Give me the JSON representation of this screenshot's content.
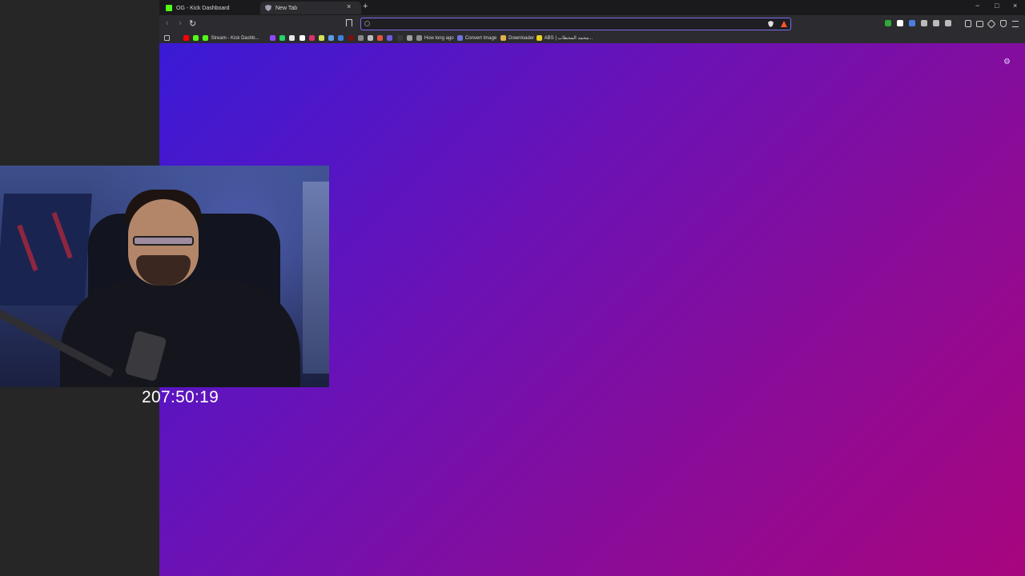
{
  "tabs": [
    {
      "label": "OG - Kick Dashboard",
      "icon": "kick-logo-icon",
      "active": false
    },
    {
      "label": "New Tab",
      "icon": "brave-shield-icon",
      "active": true
    }
  ],
  "tab_close_symbol": "×",
  "new_tab_symbol": "+",
  "window_controls": {
    "minimize": "−",
    "maximize": "□",
    "close": "×"
  },
  "nav": {
    "back": "‹",
    "forward": "›",
    "reload": "↻"
  },
  "address_bar": {
    "value": ""
  },
  "bookmarks": [
    {
      "label": "",
      "icon": "youtube-icon",
      "color": "#ff0000"
    },
    {
      "label": "",
      "icon": "kick-icon",
      "color": "#53fc18"
    },
    {
      "label": "Stream - Kick Dashb...",
      "icon": "kick-icon",
      "color": "#53fc18"
    },
    {
      "label": "",
      "icon": "twitch-icon",
      "color": "#9146ff"
    },
    {
      "label": "",
      "icon": "whatsapp-icon",
      "color": "#25d366"
    },
    {
      "label": "",
      "icon": "x-icon",
      "color": "#e6e6e6"
    },
    {
      "label": "",
      "icon": "tiktok-icon",
      "color": "#ffffff"
    },
    {
      "label": "",
      "icon": "instagram-icon",
      "color": "#e1306c"
    },
    {
      "label": "",
      "icon": "app-icon",
      "color": "#d4e157"
    },
    {
      "label": "",
      "icon": "app-icon",
      "color": "#5c9ded"
    },
    {
      "label": "",
      "icon": "check-icon",
      "color": "#3f7fe0"
    },
    {
      "label": "",
      "icon": "app-icon",
      "color": "#7a1010"
    },
    {
      "label": "",
      "icon": "app-icon",
      "color": "#888888"
    },
    {
      "label": "",
      "icon": "app-icon",
      "color": "#bbbbbb"
    },
    {
      "label": "",
      "icon": "app-icon",
      "color": "#e2543d"
    },
    {
      "label": "",
      "icon": "app-icon",
      "color": "#6b5be0"
    },
    {
      "label": "",
      "icon": "app-icon",
      "color": "#3a3a3a"
    },
    {
      "label": "",
      "icon": "link-icon",
      "color": "#a0a0a0"
    },
    {
      "label": "How long ago",
      "icon": "link-icon",
      "color": "#8c8c8c"
    },
    {
      "label": "Convert Image",
      "icon": "globe-icon",
      "color": "#6c74e0"
    },
    {
      "label": "Downloader",
      "icon": "download-icon",
      "color": "#e0b050"
    },
    {
      "label": "ABS | محمد المحطاب...",
      "icon": "app-icon",
      "color": "#e8d020"
    }
  ],
  "extensions": [
    {
      "icon": "ext-green-icon",
      "color": "#2faa3a"
    },
    {
      "icon": "ext-diamond-icon",
      "color": "#ffffff"
    },
    {
      "icon": "ext-audio-icon",
      "color": "#4a7fe0"
    },
    {
      "icon": "ext-gamepad-icon",
      "color": "#bbbbbb"
    },
    {
      "icon": "ext-puzzle-icon",
      "color": "#bbbbbb"
    },
    {
      "icon": "ext-screenshot-icon",
      "color": "#bbbbbb"
    }
  ],
  "overlay": {
    "timer": "207:50:19"
  }
}
